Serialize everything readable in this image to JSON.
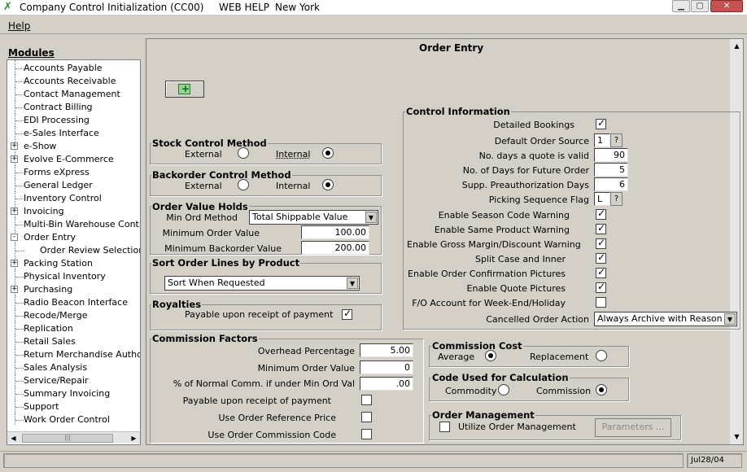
{
  "window": {
    "title": "Company Control Initialization (CC00)",
    "web_help": "WEB HELP",
    "location": "New York"
  },
  "menu": {
    "help": "Help"
  },
  "modules": {
    "heading": "Modules",
    "items": [
      {
        "label": "Accounts Payable",
        "expander": false
      },
      {
        "label": "Accounts Receivable",
        "expander": false
      },
      {
        "label": "Contact Management",
        "expander": false
      },
      {
        "label": "Contract Billing",
        "expander": false
      },
      {
        "label": "EDI Processing",
        "expander": false
      },
      {
        "label": "e-Sales Interface",
        "expander": false
      },
      {
        "label": "e-Show",
        "expander": true,
        "state": "+"
      },
      {
        "label": "Evolve E-Commerce",
        "expander": true,
        "state": "+"
      },
      {
        "label": "Forms eXpress",
        "expander": false
      },
      {
        "label": "General Ledger",
        "expander": false
      },
      {
        "label": "Inventory Control",
        "expander": false
      },
      {
        "label": "Invoicing",
        "expander": true,
        "state": "+"
      },
      {
        "label": "Multi-Bin Warehouse Control",
        "expander": false
      },
      {
        "label": "Order Entry",
        "expander": true,
        "state": "-"
      },
      {
        "label": "Order Review Selection P",
        "expander": false,
        "child": true
      },
      {
        "label": "Packing Station",
        "expander": true,
        "state": "+"
      },
      {
        "label": "Physical Inventory",
        "expander": false
      },
      {
        "label": "Purchasing",
        "expander": true,
        "state": "+"
      },
      {
        "label": "Radio Beacon Interface",
        "expander": false
      },
      {
        "label": "Recode/Merge",
        "expander": false
      },
      {
        "label": "Replication",
        "expander": false
      },
      {
        "label": "Retail Sales",
        "expander": false
      },
      {
        "label": "Return Merchandise Authoriz",
        "expander": false
      },
      {
        "label": "Sales Analysis",
        "expander": false
      },
      {
        "label": "Service/Repair",
        "expander": false
      },
      {
        "label": "Summary Invoicing",
        "expander": false
      },
      {
        "label": "Support",
        "expander": false
      },
      {
        "label": "Work Order Control",
        "expander": false
      }
    ]
  },
  "page": {
    "title": "Order Entry"
  },
  "stock_control": {
    "title": "Stock Control Method",
    "external": "External",
    "internal": "Internal",
    "selected": "Internal"
  },
  "backorder_control": {
    "title": "Backorder Control Method",
    "external": "External",
    "internal": "Internal",
    "selected": "Internal"
  },
  "order_value_holds": {
    "title": "Order Value Holds",
    "min_ord_method_label": "Min Ord Method",
    "min_ord_method_value": "Total Shippable Value",
    "min_order_value_label": "Minimum Order Value",
    "min_order_value": "100.00",
    "min_backorder_value_label": "Minimum Backorder Value",
    "min_backorder_value": "200.00"
  },
  "sort_order": {
    "title": "Sort Order Lines by Product",
    "value": "Sort When Requested"
  },
  "royalties": {
    "title": "Royalties",
    "payable_label": "Payable upon receipt of payment",
    "payable_checked": true
  },
  "commission_factors": {
    "title": "Commission Factors",
    "overhead_label": "Overhead Percentage",
    "overhead_value": "5.00",
    "min_order_label": "Minimum Order Value",
    "min_order_value": "0",
    "pct_normal_label": "% of Normal Comm. if under Min Ord Val",
    "pct_normal_value": ".00",
    "payable_label": "Payable upon receipt of payment",
    "payable_checked": false,
    "use_ref_price_label": "Use Order Reference Price",
    "use_ref_price_checked": false,
    "use_comm_code_label": "Use Order Commission Code",
    "use_comm_code_checked": false
  },
  "control_info": {
    "title": "Control Information",
    "detailed_bookings_label": "Detailed Bookings",
    "detailed_bookings": true,
    "default_source_label": "Default Order Source",
    "default_source_value": "1",
    "quote_days_label": "No. days a quote is valid",
    "quote_days_value": "90",
    "future_days_label": "No. of Days for Future Order",
    "future_days_value": "5",
    "preauth_label": "Supp. Preauthorization Days",
    "preauth_value": "6",
    "picking_label": "Picking Sequence Flag",
    "picking_value": "L",
    "season_label": "Enable Season Code Warning",
    "season": true,
    "same_product_label": "Enable Same Product Warning",
    "same_product": true,
    "gross_margin_label": "Enable Gross Margin/Discount Warning",
    "gross_margin": true,
    "split_case_label": "Split Case and Inner",
    "split_case": true,
    "confirm_pictures_label": "Enable Order Confirmation Pictures",
    "confirm_pictures": true,
    "quote_pictures_label": "Enable Quote Pictures",
    "quote_pictures": true,
    "fo_account_label": "F/O Account for Week-End/Holiday",
    "fo_account": false,
    "cancelled_label": "Cancelled Order Action",
    "cancelled_value": "Always Archive with Reason",
    "question": "?"
  },
  "commission_cost": {
    "title": "Commission Cost",
    "average": "Average",
    "replacement": "Replacement",
    "selected": "Average"
  },
  "code_calc": {
    "title": "Code Used for Calculation",
    "commodity": "Commodity",
    "commission": "Commission",
    "selected": "Commission"
  },
  "order_management": {
    "title": "Order Management",
    "utilize_label": "Utilize Order Management",
    "utilize_checked": false,
    "parameters_button": "Parameters ..."
  },
  "status": {
    "date": "Jul28/04"
  }
}
